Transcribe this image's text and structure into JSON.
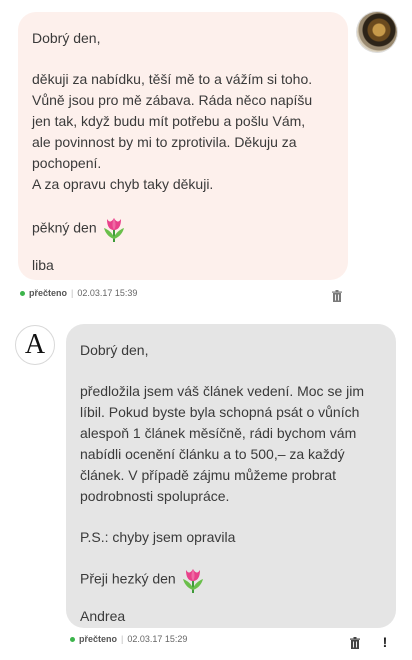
{
  "messages": [
    {
      "greeting": "Dobrý den,",
      "body_lines": [
        "děkuji za nabídku, těší mě to a vážím si toho.",
        "Vůně jsou pro mě zábava. Ráda něco napíšu",
        "jen tak, když budu mít potřebu a pošlu Vám,",
        "ale povinnost by mi to zprotivila. Děkuju za",
        "pochopení.",
        "A za opravu chyb taky děkuji."
      ],
      "closing": "pěkný den",
      "signature": "liba",
      "status": "přečteno",
      "timestamp": "02.03.17 15:39",
      "avatar_icon": "user-photo"
    },
    {
      "greeting": "Dobrý den,",
      "body_lines": [
        "předložila jsem váš článek vedení. Moc se jim",
        "líbil. Pokud byste byla schopná psát o vůních",
        "alespoň 1 článek měsíčně, rádi bychom vám",
        "nabídli ocenění článku a to 500,– za každý",
        "článek. V případě zájmu můžeme probrat",
        "podrobnosti spolupráce."
      ],
      "ps": "P.S.: chyby jsem opravila",
      "closing": "Přeji hezký den",
      "signature": "Andrea",
      "status": "přečteno",
      "timestamp": "02.03.17 15:29",
      "avatar_letter": "A"
    }
  ],
  "icons": {
    "trash": "trash-icon",
    "report": "exclamation-icon",
    "tulip": "tulip-emoji",
    "read": "read-status-dot"
  },
  "colors": {
    "outgoing_bubble": "#fdf0ec",
    "incoming_bubble": "#e5e5e5",
    "read_dot": "#3cb44b"
  }
}
